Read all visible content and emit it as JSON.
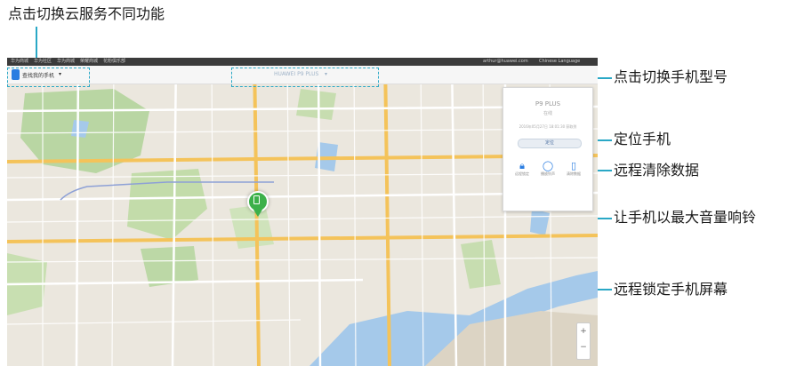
{
  "annotations": {
    "switch_service": "点击切换云服务不同功能",
    "switch_model": "点击切换手机型号",
    "locate_phone": "定位手机",
    "remote_wipe": "远程清除数据",
    "ring_phone": "让手机以最大音量响铃",
    "remote_lock": "远程锁定手机屏幕"
  },
  "screenshot": {
    "topbar_items": [
      "华为商城",
      "华为社区",
      "华为商城",
      "荣耀商城",
      "花粉俱乐部"
    ],
    "user_email": "arthur@huawei.com",
    "language": "Chinese Language",
    "service_menu": "查找我的手机",
    "device_selector": "HUAWEI P9 PLUS",
    "panel": {
      "device_name": "P9 PLUS",
      "status": "在线",
      "timestamp": "2016年05月27日 18:01:30 获取到",
      "locate_button": "定位",
      "actions": [
        {
          "icon": "lock-icon",
          "label": "远程锁定"
        },
        {
          "icon": "speech-bubble-icon",
          "label": "播放铃声"
        },
        {
          "icon": "wipe-icon",
          "label": "清除数据"
        }
      ]
    },
    "colors": {
      "accent": "#2aa8c6",
      "brand": "#2a7de1",
      "pin": "#3cb04a"
    }
  }
}
